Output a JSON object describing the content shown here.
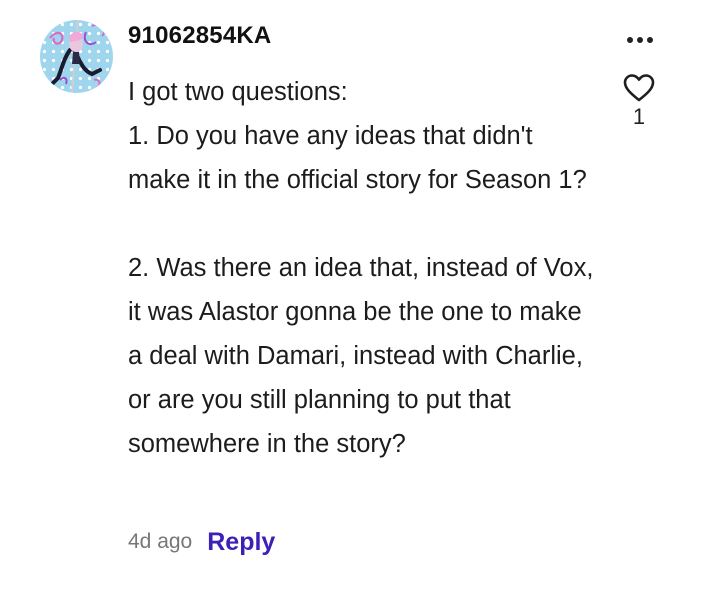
{
  "comment": {
    "avatar_icon": "user-avatar",
    "username": "91062854KA",
    "more_icon": "more-horizontal-icon",
    "like_icon": "heart-outline-icon",
    "like_count": "1",
    "body": "I got two questions:\n1. Do you have any ideas that didn't make it in the official story for Season 1?\n\n2. Was there an idea that, instead of Vox, it was Alastor gonna be the one to make a deal with Damari, instead with Charlie, or are you still planning to put that somewhere in the story?",
    "timestamp": "4d ago",
    "reply_label": "Reply",
    "accent_color": "#3d20b8"
  }
}
